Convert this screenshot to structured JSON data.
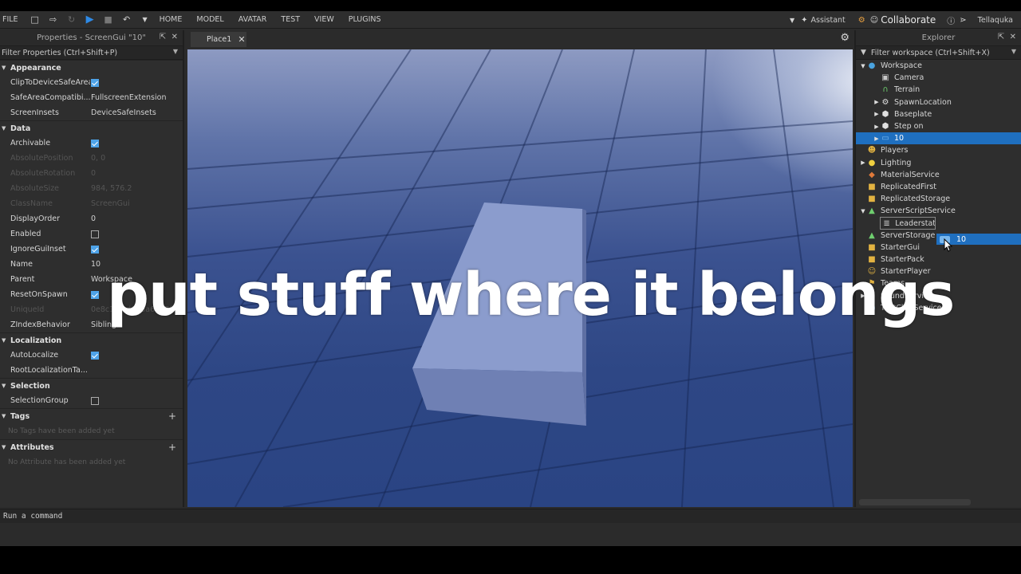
{
  "menubar": {
    "file": "FILE",
    "tabs": [
      "HOME",
      "MODEL",
      "AVATAR",
      "TEST",
      "VIEW",
      "PLUGINS"
    ],
    "assistant": "Assistant",
    "collaborate": "Collaborate",
    "username": "Tellaquka"
  },
  "properties": {
    "title": "Properties - ScreenGui \"10\"",
    "filter": "Filter Properties (Ctrl+Shift+P)",
    "sections": {
      "appearance": "Appearance",
      "data": "Data",
      "localization": "Localization",
      "selection": "Selection",
      "tags": "Tags",
      "attributes": "Attributes"
    },
    "rows": {
      "clip": {
        "name": "ClipToDeviceSafeArea",
        "checked": true
      },
      "safearea": {
        "name": "SafeAreaCompatibi...",
        "value": "FullscreenExtension"
      },
      "insets": {
        "name": "ScreenInsets",
        "value": "DeviceSafeInsets"
      },
      "archivable": {
        "name": "Archivable",
        "checked": true
      },
      "abspos": {
        "name": "AbsolutePosition",
        "value": "0, 0"
      },
      "absrot": {
        "name": "AbsoluteRotation",
        "value": "0"
      },
      "abssize": {
        "name": "AbsoluteSize",
        "value": "984, 576.2"
      },
      "classname": {
        "name": "ClassName",
        "value": "ScreenGui"
      },
      "displayorder": {
        "name": "DisplayOrder",
        "value": "0"
      },
      "enabled": {
        "name": "Enabled",
        "checked": false
      },
      "ignoreinset": {
        "name": "IgnoreGuiInset",
        "checked": true
      },
      "name": {
        "name": "Name",
        "value": "10"
      },
      "parent": {
        "name": "Parent",
        "value": "Workspace"
      },
      "resetonspawn": {
        "name": "ResetOnSpawn",
        "checked": true
      },
      "uniqueid": {
        "name": "UniqueId",
        "value": "0e8c1...ed028a6007fe..."
      },
      "zindex": {
        "name": "ZIndexBehavior",
        "value": "Sibling"
      },
      "autolocalize": {
        "name": "AutoLocalize",
        "checked": true
      },
      "rootloc": {
        "name": "RootLocalizationTa...",
        "value": ""
      },
      "selgroup": {
        "name": "SelectionGroup",
        "checked": false
      }
    },
    "no_tags": "No Tags have been added yet",
    "no_attributes": "No Attribute has been added yet"
  },
  "viewport": {
    "tab": "Place1"
  },
  "explorer": {
    "title": "Explorer",
    "filter": "Filter workspace (Ctrl+Shift+X)",
    "items": [
      {
        "label": "Workspace",
        "icon": "globe-icon",
        "color": "#4aa3df"
      },
      {
        "label": "Camera",
        "icon": "camera-icon",
        "color": "#c8c8c8"
      },
      {
        "label": "Terrain",
        "icon": "terrain-icon",
        "color": "#6fcf6f"
      },
      {
        "label": "SpawnLocation",
        "icon": "gear-icon",
        "color": "#e0e0e0"
      },
      {
        "label": "Baseplate",
        "icon": "cube-icon",
        "color": "#e0e0e0"
      },
      {
        "label": "Step on",
        "icon": "cube-icon",
        "color": "#e0e0e0"
      },
      {
        "label": "10",
        "icon": "screengui-icon",
        "color": "#7ab8ee"
      },
      {
        "label": "Players",
        "icon": "players-icon",
        "color": "#e3b341"
      },
      {
        "label": "Lighting",
        "icon": "bulb-icon",
        "color": "#f0d040"
      },
      {
        "label": "MaterialService",
        "icon": "material-icon",
        "color": "#e07a3a"
      },
      {
        "label": "ReplicatedFirst",
        "icon": "replicated-icon",
        "color": "#e3b341"
      },
      {
        "label": "ReplicatedStorage",
        "icon": "storage-icon",
        "color": "#e3b341"
      },
      {
        "label": "ServerScriptService",
        "icon": "server-icon",
        "color": "#6fcf6f"
      },
      {
        "label": "Leaderstat",
        "icon": "script-icon",
        "color": "#d0d0d0"
      },
      {
        "label": "ServerStorage",
        "icon": "server-storage-icon",
        "color": "#6fcf6f"
      },
      {
        "label": "StarterGui",
        "icon": "startergui-icon",
        "color": "#e3b341"
      },
      {
        "label": "StarterPack",
        "icon": "starterpack-icon",
        "color": "#e3b341"
      },
      {
        "label": "StarterPlayer",
        "icon": "starterplayer-icon",
        "color": "#e3b341"
      },
      {
        "label": "Teams",
        "icon": "teams-icon",
        "color": "#e3b341"
      },
      {
        "label": "SoundService",
        "icon": "sound-icon",
        "color": "#e3b341"
      },
      {
        "label": "TextChatService",
        "icon": "chat-icon",
        "color": "#6fb6e8"
      }
    ],
    "drag_label": "10"
  },
  "command": {
    "placeholder": "Run a command"
  },
  "caption": "put stuff where it belongs"
}
